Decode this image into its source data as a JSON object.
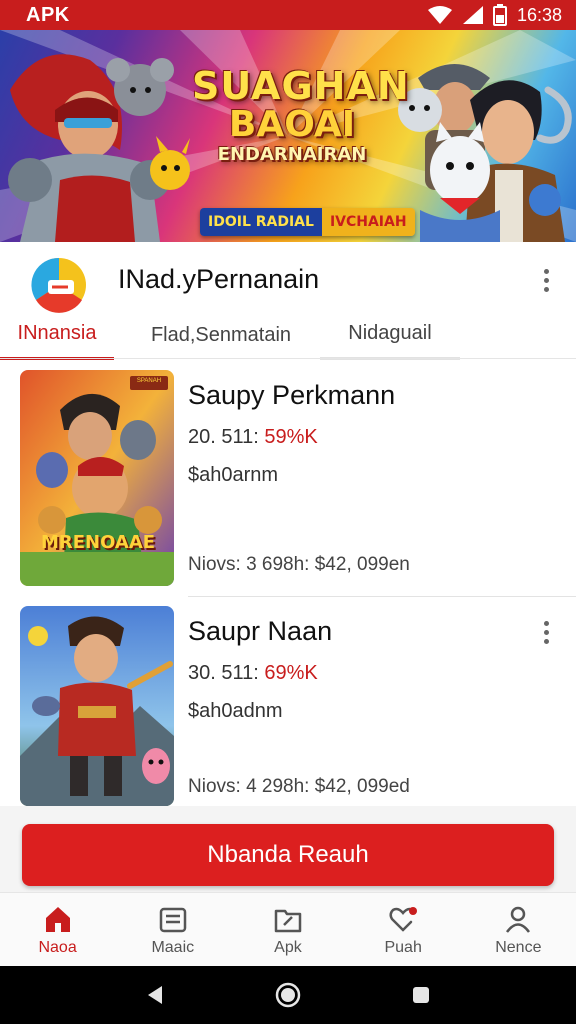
{
  "status_bar": {
    "left_text": "APK",
    "time": "16:38"
  },
  "banner": {
    "title_line1": "SUAGHAN",
    "title_line2": "BAOAI",
    "title_line3": "ENDARNAIRAN",
    "tag_left": "IDOIL RADIAL",
    "tag_right": "IVCHAIAH"
  },
  "app_header": {
    "title": "INad.yPernanain",
    "tabs": [
      {
        "label": "INnansia",
        "active": true
      },
      {
        "label": "Flad,Senmatain",
        "active": false
      },
      {
        "label": "Nidaguail",
        "active": false
      }
    ]
  },
  "list": {
    "items": [
      {
        "title": "Saupy Perkmann",
        "stat_prefix": "20. 511:",
        "stat_value": "59%K",
        "price": "$ah0arnm",
        "meta": "Niovs:  3 698h:  $42, 099en",
        "thumb_label": "MRENOAAE",
        "thumb_badge": "SPANAH"
      },
      {
        "title": "Saupr Naan",
        "stat_prefix": "30. 511:",
        "stat_value": "69%K",
        "price": "$ah0adnm",
        "meta": "Niovs:  4 298h:  $42, 099ed",
        "thumb_label": "",
        "thumb_badge": ""
      }
    ]
  },
  "cta": {
    "label": "Nbanda Reauh"
  },
  "bottom_nav": {
    "items": [
      {
        "label": "Naoa",
        "icon": "home-icon",
        "active": true
      },
      {
        "label": "Maaic",
        "icon": "bag-icon",
        "active": false
      },
      {
        "label": "Apk",
        "icon": "folder-icon",
        "active": false
      },
      {
        "label": "Puah",
        "icon": "heart-notification-icon",
        "active": false
      },
      {
        "label": "Nence",
        "icon": "profile-icon",
        "active": false
      }
    ]
  },
  "colors": {
    "accent": "#c81d1d",
    "cta": "#dc1f1f",
    "background": "#ffffff"
  }
}
